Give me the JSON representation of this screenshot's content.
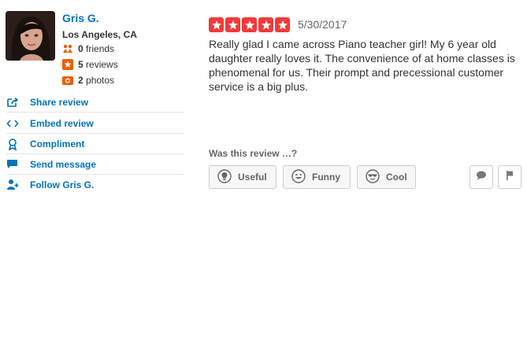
{
  "user": {
    "name": "Gris G.",
    "location": "Los Angeles, CA",
    "friends": {
      "count": "0",
      "label": "friends"
    },
    "reviews": {
      "count": "5",
      "label": "reviews"
    },
    "photos": {
      "count": "2",
      "label": "photos"
    }
  },
  "actions": [
    {
      "label": "Share review",
      "icon": "share-icon"
    },
    {
      "label": "Embed review",
      "icon": "embed-icon"
    },
    {
      "label": "Compliment",
      "icon": "compliment-icon"
    },
    {
      "label": "Send message",
      "icon": "message-icon"
    },
    {
      "label": "Follow Gris G.",
      "icon": "follow-icon"
    }
  ],
  "review": {
    "rating": 5,
    "date": "5/30/2017",
    "text": "Really glad I came across Piano teacher girl! My 6 year old daughter really loves it. The convenience of at home classes is phenomenal for us. Their prompt and precessional customer service is a big plus.",
    "helpful_prompt": "Was this review …?",
    "votes": [
      {
        "label": "Useful",
        "icon": "lightbulb-icon"
      },
      {
        "label": "Funny",
        "icon": "smiley-icon"
      },
      {
        "label": "Cool",
        "icon": "sunglasses-icon"
      }
    ]
  },
  "colors": {
    "link": "#0073bb",
    "star": "#f43939",
    "stat_friends": "#f15c00",
    "stat_reviews": "#f15c00",
    "stat_photos": "#f15c00"
  }
}
